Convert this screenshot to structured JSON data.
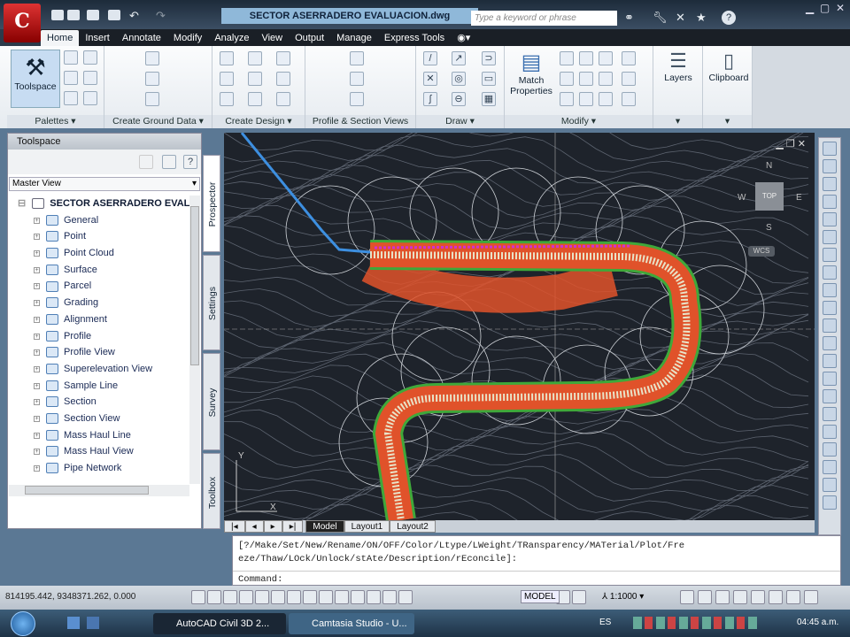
{
  "app": {
    "logo": "C",
    "title": "SECTOR ASERRADERO EVALUACION.dwg",
    "search_placeholder": "Type a keyword or phrase"
  },
  "tabs": [
    "Home",
    "Insert",
    "Annotate",
    "Modify",
    "Analyze",
    "View",
    "Output",
    "Manage",
    "Express Tools"
  ],
  "ribbon": {
    "panels": [
      "Palettes",
      "Create Ground Data",
      "Create Design",
      "Profile & Section Views",
      "Draw",
      "Modify",
      "",
      ""
    ],
    "toolspace": "Toolspace",
    "match": "Match",
    "properties": "Properties",
    "layers": "Layers",
    "clipboard": "Clipboard"
  },
  "toolspace": {
    "title": "Toolspace",
    "view": "Master View",
    "root": "SECTOR ASERRADERO EVAL...",
    "items": [
      "General",
      "Point",
      "Point Cloud",
      "Surface",
      "Parcel",
      "Grading",
      "Alignment",
      "Profile",
      "Profile View",
      "Superelevation View",
      "Sample Line",
      "Section",
      "Section View",
      "Mass Haul Line",
      "Mass Haul View",
      "Pipe Network"
    ],
    "tabs": [
      "Prospector",
      "Settings",
      "Survey",
      "Toolbox"
    ]
  },
  "viewcube": {
    "n": "N",
    "s": "S",
    "e": "E",
    "w": "W",
    "top": "TOP",
    "wcs": "WCS"
  },
  "ucs": {
    "x": "X",
    "y": "Y"
  },
  "layout_tabs": [
    "Model",
    "Layout1",
    "Layout2"
  ],
  "command": {
    "line1": "[?/Make/Set/New/Rename/ON/OFF/Color/Ltype/LWeight/TRansparency/MATerial/Plot/Fre",
    "line2": "eze/Thaw/LOck/Unlock/stAte/Description/rEconcile]:",
    "prompt": "Command:"
  },
  "status": {
    "coords": "814195.442, 9348371.262, 0.000",
    "model": "MODEL",
    "scale": "1:1000"
  },
  "taskbar": {
    "tasks": [
      "AutoCAD Civil 3D 2...",
      "Camtasia Studio - U..."
    ],
    "lang": "ES",
    "time": "04:45 a.m."
  },
  "colors": {
    "road": "#e0522a",
    "edge": "#3fa83a",
    "alignment": "#3d8fe0",
    "contour": "#5d6470"
  }
}
